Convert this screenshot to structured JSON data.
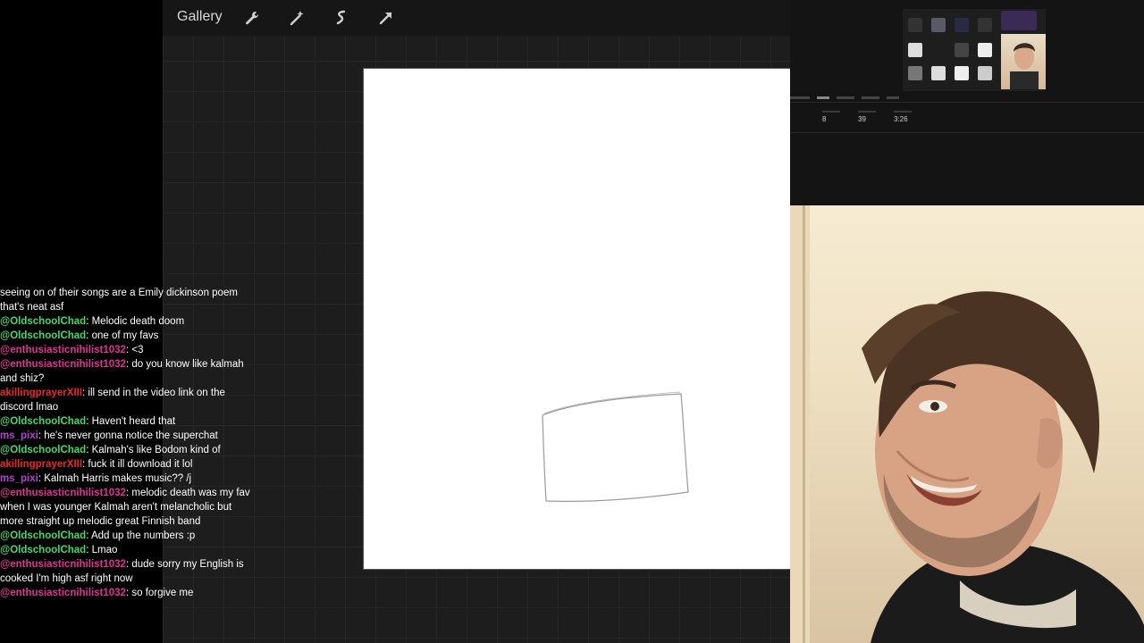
{
  "procreate": {
    "gallery_label": "Gallery",
    "tools": [
      {
        "name": "wrench-icon"
      },
      {
        "name": "magic-wand-icon"
      },
      {
        "name": "selection-icon"
      },
      {
        "name": "transform-arrow-icon"
      }
    ]
  },
  "chat": {
    "messages": [
      {
        "user": "",
        "text": "seeing on of their songs are a Emily dickinson poem that's neat asf"
      },
      {
        "user": "@OldschoolChad",
        "color": "#3ddc6a",
        "text": ": Melodic death doom"
      },
      {
        "user": "@OldschoolChad",
        "color": "#3ddc6a",
        "text": ": one of my favs"
      },
      {
        "user": "@enthusiasticnihilist1032",
        "color": "#e0309a",
        "text": ": <3"
      },
      {
        "user": "@enthusiasticnihilist1032",
        "color": "#e0309a",
        "text": ": do you know like kalmah and shiz?"
      },
      {
        "user": "akillingprayerXIII",
        "color": "#e8262b",
        "text": ": ill send in the video link on the discord lmao"
      },
      {
        "user": "@OldschoolChad",
        "color": "#3ddc6a",
        "text": ": Haven't heard that"
      },
      {
        "user": "ms_pixi",
        "color": "#b640d8",
        "text": ": he's never gonna notice the superchat"
      },
      {
        "user": "@OldschoolChad",
        "color": "#3ddc6a",
        "text": ": Kalmah's like Bodom kind of"
      },
      {
        "user": "akillingprayerXIII",
        "color": "#e8262b",
        "text": ": fuck it ill download it lol"
      },
      {
        "user": "ms_pixi",
        "color": "#b640d8",
        "text": ": Kalmah Harris makes music?? /j"
      },
      {
        "user": "@enthusiasticnihilist1032",
        "color": "#e0309a",
        "text": ": melodic death was my fav when I was younger Kalmah aren't melancholic but more straight up melodic great Finnish band"
      },
      {
        "user": "@OldschoolChad",
        "color": "#3ddc6a",
        "text": ": Add up the numbers :p"
      },
      {
        "user": "@OldschoolChad",
        "color": "#3ddc6a",
        "text": ": Lmao"
      },
      {
        "user": "@enthusiasticnihilist1032",
        "color": "#e0309a",
        "text": ": dude sorry my English is cooked I'm high asf right now"
      },
      {
        "user": "@enthusiasticnihilist1032",
        "color": "#e0309a",
        "text": ": so forgive me"
      }
    ]
  },
  "screen_preview": {
    "stats": [
      "8",
      "39",
      "3:26"
    ]
  }
}
